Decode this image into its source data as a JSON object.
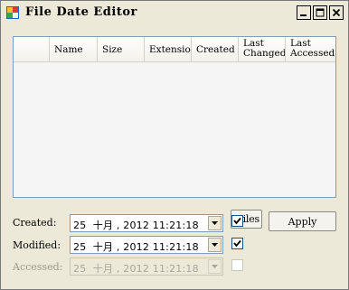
{
  "window": {
    "title": "File Date Editor"
  },
  "caption_buttons": {
    "minimize": "_",
    "maximize": "□",
    "close": "x"
  },
  "listview": {
    "columns": [
      {
        "label": ""
      },
      {
        "label": "Name"
      },
      {
        "label": "Size"
      },
      {
        "label": "Extensio"
      },
      {
        "label": "Created"
      },
      {
        "label": "Last\nChanged"
      },
      {
        "label": "Last\nAccessed"
      }
    ],
    "rows": []
  },
  "form": {
    "created": {
      "label": "Created:",
      "value": "25  十月 , 2012 11:21:18",
      "checked": true
    },
    "modified": {
      "label": "Modified:",
      "value": "25  十月 , 2012 11:21:18",
      "checked": true
    },
    "accessed": {
      "label": "Accessed:",
      "value": "25  十月 , 2012 11:21:18",
      "checked": false,
      "disabled": true
    }
  },
  "buttons": {
    "hidden_behind": "Files",
    "apply": "Apply"
  },
  "colors": {
    "window_bg": "#ece9d8",
    "list_bg": "#f5f5f5",
    "border": "#7f9db9"
  },
  "icons": {
    "app": "app-icon",
    "dropdown": "chevron-down-icon",
    "check": "check-icon"
  }
}
